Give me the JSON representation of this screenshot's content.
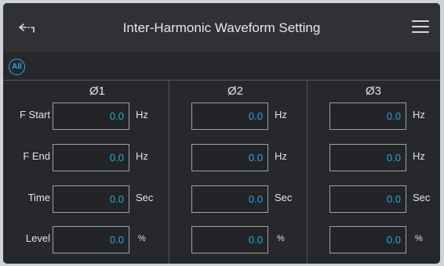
{
  "header": {
    "title": "Inter-Harmonic Waveform Setting"
  },
  "toolbar": {
    "all_label": "All"
  },
  "phases": [
    "Ø1",
    "Ø2",
    "Ø3"
  ],
  "rows": [
    {
      "label": "F Start",
      "unit": "Hz",
      "values": [
        "0.0",
        "0.0",
        "0.0"
      ]
    },
    {
      "label": "F End",
      "unit": "Hz",
      "values": [
        "0.0",
        "0.0",
        "0.0"
      ]
    },
    {
      "label": "Time",
      "unit": "Sec",
      "values": [
        "0.0",
        "0.0",
        "0.0"
      ]
    },
    {
      "label": "Level",
      "unit": "%",
      "values": [
        "0.0",
        "0.0",
        "0.0"
      ]
    }
  ],
  "colors": {
    "accent": "#29a9e0",
    "background": "#26282c",
    "titlebar": "#2f3135"
  },
  "icons": {
    "back": "back-arrow-icon",
    "menu": "hamburger-menu-icon"
  }
}
